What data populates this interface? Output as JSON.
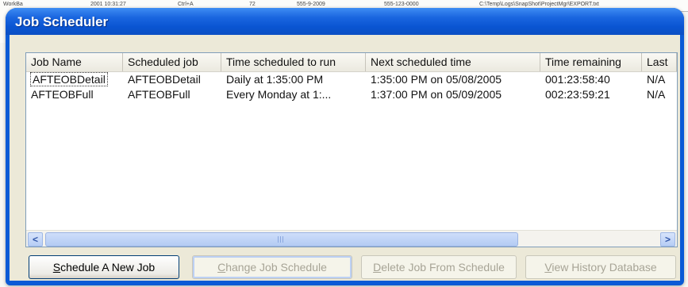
{
  "background": {
    "strip": [
      "WorkBa",
      "2001 10:31:27",
      "Ctrl+A",
      "72",
      "555-9-2009",
      "555-123-0000",
      "C:\\Temp\\Logs\\SnapShot\\ProjectMgr\\EXPORT.txt"
    ]
  },
  "window": {
    "title": "Job Scheduler",
    "accent_color": "#0a55d2"
  },
  "listview": {
    "columns": [
      "Job Name",
      "Scheduled job",
      "Time scheduled to run",
      "Next scheduled time",
      "Time remaining",
      "Last"
    ],
    "rows": [
      [
        "AFTEOBDetail",
        "AFTEOBDetail",
        "Daily at  1:35:00 PM",
        "1:35:00 PM on 05/08/2005",
        "001:23:58:40",
        "N/A"
      ],
      [
        "AFTEOBFull",
        "AFTEOBFull",
        "Every Monday at  1:...",
        "1:37:00 PM on 05/09/2005",
        "002:23:59:21",
        "N/A"
      ]
    ]
  },
  "scrollbar": {
    "left_arrow": "<",
    "right_arrow": ">"
  },
  "buttons": {
    "schedule_new_mnemonic": "S",
    "schedule_new_rest": "chedule A New Job",
    "change_mnemonic": "C",
    "change_rest": "hange Job Schedule",
    "delete_mnemonic": "D",
    "delete_rest": "elete Job From Schedule",
    "history_mnemonic": "V",
    "history_rest": "iew History Database"
  }
}
